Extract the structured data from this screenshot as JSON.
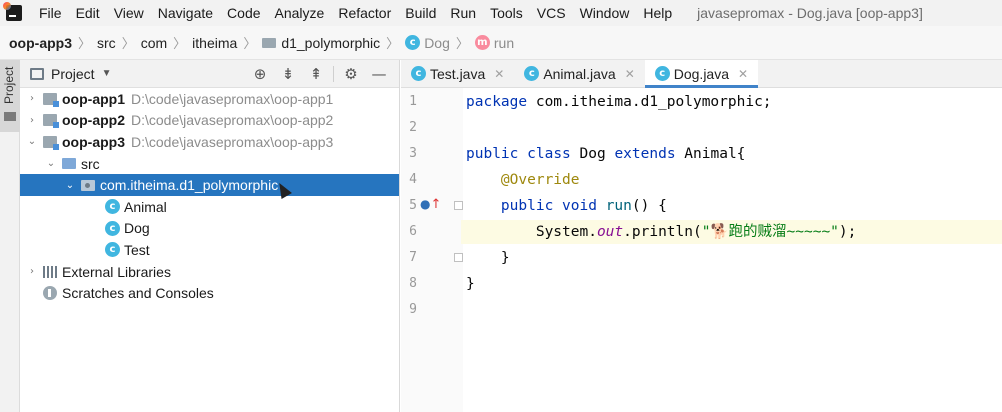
{
  "menubar": {
    "items": [
      "File",
      "Edit",
      "View",
      "Navigate",
      "Code",
      "Analyze",
      "Refactor",
      "Build",
      "Run",
      "Tools",
      "VCS",
      "Window",
      "Help"
    ],
    "title": "javasepromax - Dog.java [oop-app3]"
  },
  "breadcrumb": {
    "items": [
      "oop-app3",
      "src",
      "com",
      "itheima",
      "d1_polymorphic",
      "Dog",
      "run"
    ]
  },
  "toolstrip": {
    "label": "Project"
  },
  "project_panel": {
    "title": "Project",
    "tree": [
      {
        "name": "oop-app1",
        "path": "D:\\code\\javasepromax\\oop-app1"
      },
      {
        "name": "oop-app2",
        "path": "D:\\code\\javasepromax\\oop-app2"
      },
      {
        "name": "oop-app3",
        "path": "D:\\code\\javasepromax\\oop-app3"
      },
      {
        "name": "src"
      },
      {
        "name": "com.itheima.d1_polymorphic"
      },
      {
        "name": "Animal"
      },
      {
        "name": "Dog"
      },
      {
        "name": "Test"
      },
      {
        "name": "External Libraries"
      },
      {
        "name": "Scratches and Consoles"
      }
    ]
  },
  "editor": {
    "tabs": [
      "Test.java",
      "Animal.java",
      "Dog.java"
    ],
    "active_tab": "Dog.java",
    "line_numbers": [
      "1",
      "2",
      "3",
      "4",
      "5",
      "6",
      "7",
      "8",
      "9"
    ],
    "code": {
      "l1_kw": "package",
      "l1_rest": " com.itheima.d1_polymorphic;",
      "l3_kw1": "public",
      "l3_kw2": "class",
      "l3_name": "Dog",
      "l3_kw3": "extends",
      "l3_rest": "Animal{",
      "l4_ann": "@Override",
      "l5_kw1": "public",
      "l5_kw2": "void",
      "l5_meth": "run",
      "l5_rest": "() {",
      "l6_a": "System.",
      "l6_static": "out",
      "l6_b": ".println(",
      "l6_str_open": "\"",
      "l6_str": "跑的贼溜~~~~~\"",
      "l6_end": ");",
      "l7": "}",
      "l8": "}"
    }
  }
}
